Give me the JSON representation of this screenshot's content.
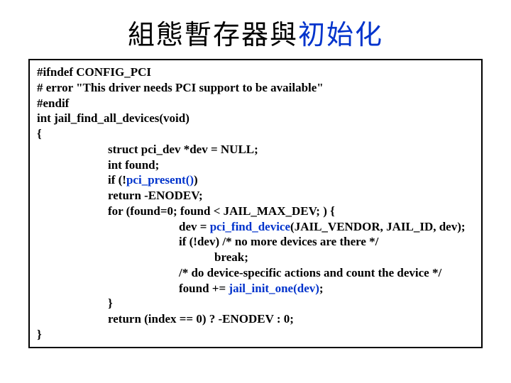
{
  "title": {
    "black": "組態暫存器與",
    "blue": "初始化"
  },
  "code": {
    "l0": "#ifndef CONFIG_PCI",
    "l1": "#  error \"This driver needs PCI support to be available\"",
    "l2": "#endif",
    "l3": "int jail_find_all_devices(void)",
    "l4": "{",
    "l5": "struct pci_dev *dev = NULL;",
    "l6": "int found;",
    "l7a": "if (!",
    "l7b": "pci_present()",
    "l7c": ")",
    "l8": "return -ENODEV;",
    "l9": "for (found=0; found < JAIL_MAX_DEV; ) {",
    "l10a": "dev = ",
    "l10b": "pci_find_device",
    "l10c": "(JAIL_VENDOR, JAIL_ID, dev);",
    "l11": "if (!dev) /* no more devices are there */",
    "l12": "break;",
    "l13": "/* do device-specific actions and count the device */",
    "l14a": "found += ",
    "l14b": "jail_init_one(dev)",
    "l14c": ";",
    "l15": "}",
    "l16": "return (index == 0) ? -ENODEV : 0;",
    "l17": "}"
  }
}
